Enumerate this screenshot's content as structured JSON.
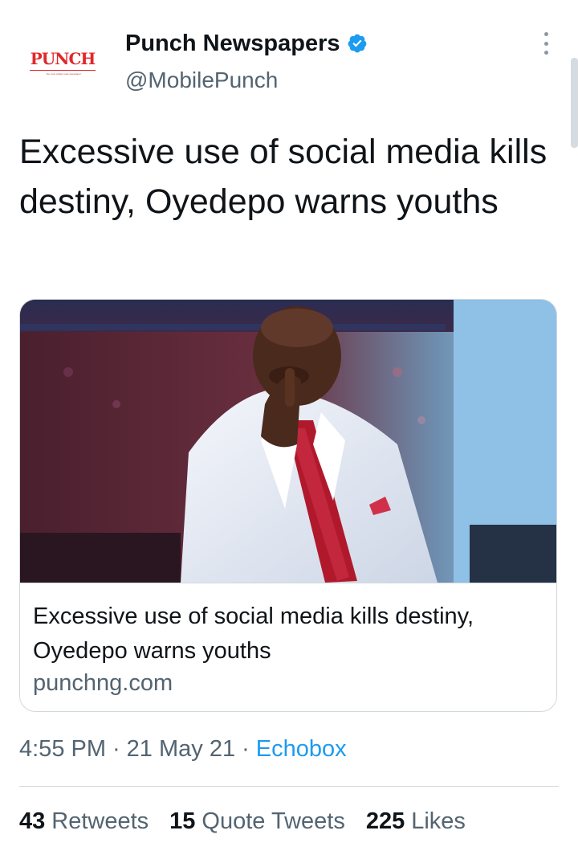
{
  "account": {
    "display_name": "Punch Newspapers",
    "handle": "@MobilePunch",
    "avatar_logo_text": "PUNCH",
    "avatar_tagline": "...the most widely read newspaper",
    "verified": true
  },
  "tweet": {
    "text": "Excessive use of social media kills destiny, Oyedepo warns youths"
  },
  "card": {
    "title": "Excessive use of social media kills destiny, Oyedepo warns youths",
    "domain": "punchng.com"
  },
  "meta": {
    "time": "4:55 PM",
    "separator": "·",
    "date": "21 May 21",
    "source": "Echobox"
  },
  "stats": {
    "retweets_count": "43",
    "retweets_label": "Retweets",
    "quotes_count": "15",
    "quotes_label": "Quote Tweets",
    "likes_count": "225",
    "likes_label": "Likes"
  },
  "colors": {
    "accent": "#1d9bf0",
    "brand_red": "#e0282b",
    "secondary_text": "#536471"
  },
  "icons": {
    "verified": "verified-badge-icon",
    "more": "more-vertical-icon"
  }
}
